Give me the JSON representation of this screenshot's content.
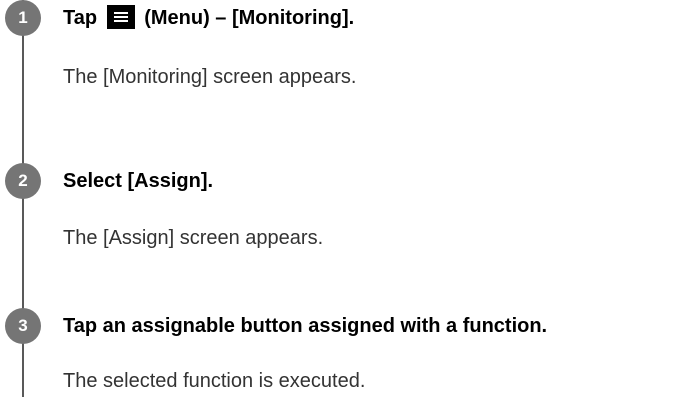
{
  "steps": [
    {
      "number": "1",
      "title_before_icon": "Tap",
      "title_after_icon": "(Menu) – [Monitoring].",
      "result": "The [Monitoring] screen appears."
    },
    {
      "number": "2",
      "title": "Select [Assign].",
      "result": "The [Assign] screen appears."
    },
    {
      "number": "3",
      "title": "Tap an assignable button assigned with a function.",
      "result": "The selected function is executed."
    }
  ],
  "icons": {
    "menu": "menu-icon"
  },
  "colors": {
    "step_circle": "#757575",
    "timeline": "#595959",
    "result_text": "#333333"
  }
}
